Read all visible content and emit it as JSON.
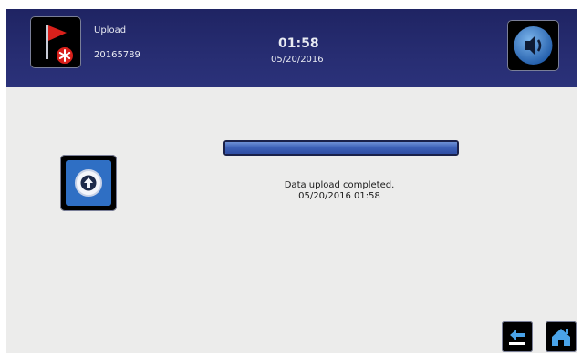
{
  "header": {
    "mode_label": "Upload",
    "id_number": "20165789",
    "time": "01:58",
    "date": "05/20/2016"
  },
  "upload": {
    "progress_percent": 100,
    "status_message": "Data upload completed.",
    "completed_timestamp": "05/20/2016 01:58"
  },
  "icons": {
    "flag": "flag-alert-icon",
    "sound": "speaker-icon",
    "upload": "upload-arrow-icon",
    "back": "back-arrow-icon",
    "home": "home-icon"
  },
  "colors": {
    "header_bg": "#272d72",
    "screen_bg": "#ececeb",
    "progress_fill": "#3e62b8",
    "flag_red": "#d9201b",
    "accent_blue": "#2f6fc4"
  }
}
